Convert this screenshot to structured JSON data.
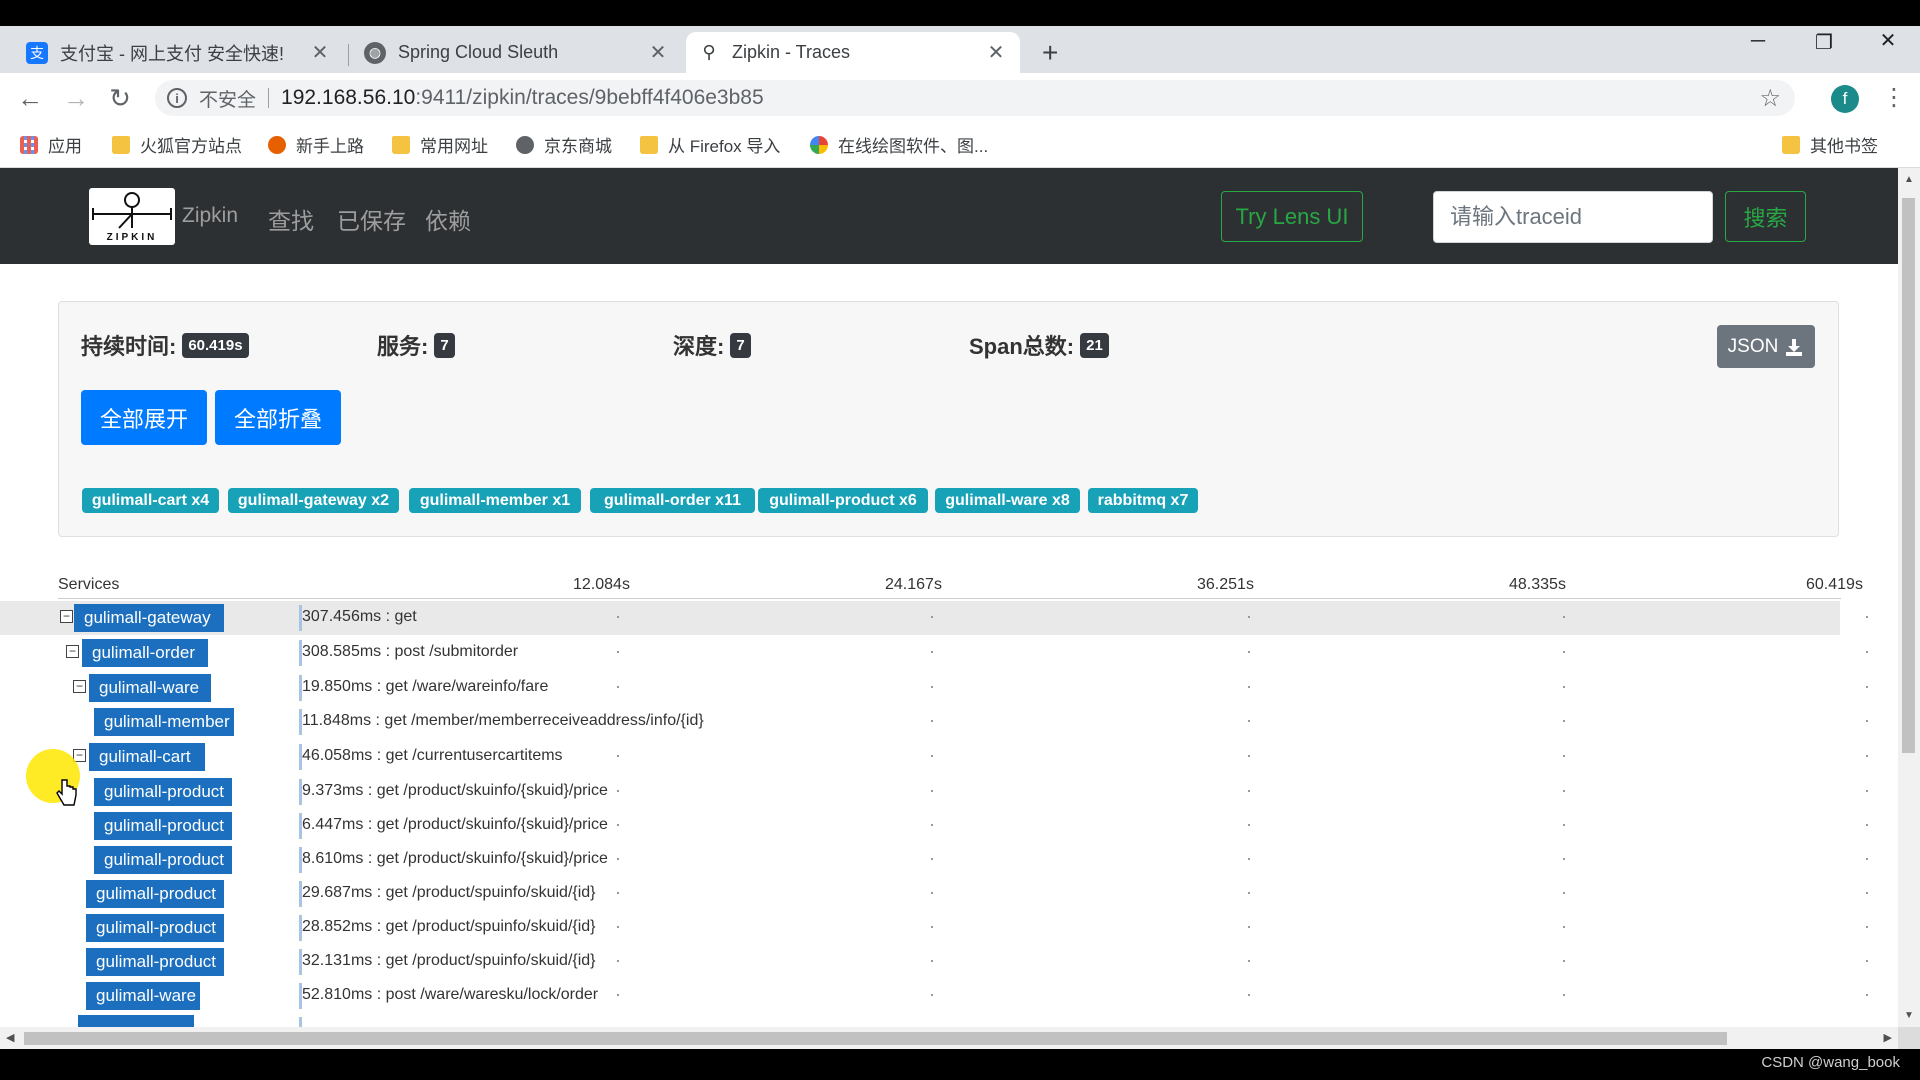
{
  "browser": {
    "tabs": [
      {
        "title": "支付宝 - 网上支付 安全快速!",
        "favicon": "alipay-icon",
        "active": false
      },
      {
        "title": "Spring Cloud Sleuth",
        "favicon": "globe-icon",
        "active": false
      },
      {
        "title": "Zipkin - Traces",
        "favicon": "zipkin-icon",
        "active": true
      }
    ],
    "new_tab": "+",
    "address": {
      "security_label": "不安全",
      "host": "192.168.56.10",
      "path": ":9411/zipkin/traces/9bebff4f406e3b85"
    },
    "profile_initial": "f",
    "bookmarks": [
      "应用",
      "火狐官方站点",
      "新手上路",
      "常用网址",
      "京东商城",
      "从 Firefox 导入",
      "在线绘图软件、图...",
      "其他书签"
    ]
  },
  "nav": {
    "brand": "Zipkin",
    "logo_text": "ZIPKIN",
    "links": [
      "查找",
      "已保存",
      "依赖"
    ],
    "lens_button": "Try Lens UI",
    "search_placeholder": "请输入traceid",
    "search_button": "搜索"
  },
  "summary": {
    "duration_label": "持续时间:",
    "duration_value": "60.419s",
    "services_label": "服务:",
    "services_value": "7",
    "depth_label": "深度:",
    "depth_value": "7",
    "spans_label": "Span总数:",
    "spans_value": "21",
    "json_button": "JSON",
    "expand_all": "全部展开",
    "collapse_all": "全部折叠",
    "service_badges": [
      "gulimall-cart x4",
      "gulimall-gateway x2",
      "gulimall-member x1",
      "gulimall-order x11",
      "gulimall-product x6",
      "gulimall-ware x8",
      "rabbitmq x7"
    ]
  },
  "timeline": {
    "services_header": "Services",
    "ticks": [
      "12.084s",
      "24.167s",
      "36.251s",
      "48.335s",
      "60.419s"
    ],
    "rows": [
      {
        "service": "gulimall-gateway",
        "label": "307.456ms : get"
      },
      {
        "service": "gulimall-order",
        "label": "308.585ms : post /submitorder"
      },
      {
        "service": "gulimall-ware",
        "label": "19.850ms : get /ware/wareinfo/fare"
      },
      {
        "service": "gulimall-member",
        "label": "11.848ms : get /member/memberreceiveaddress/info/{id}"
      },
      {
        "service": "gulimall-cart",
        "label": "46.058ms : get /currentusercartitems"
      },
      {
        "service": "gulimall-product",
        "label": "9.373ms : get /product/skuinfo/{skuid}/price"
      },
      {
        "service": "gulimall-product",
        "label": "6.447ms : get /product/skuinfo/{skuid}/price"
      },
      {
        "service": "gulimall-product",
        "label": "8.610ms : get /product/skuinfo/{skuid}/price"
      },
      {
        "service": "gulimall-product",
        "label": "29.687ms : get /product/spuinfo/skuid/{id}"
      },
      {
        "service": "gulimall-product",
        "label": "28.852ms : get /product/spuinfo/skuid/{id}"
      },
      {
        "service": "gulimall-product",
        "label": "32.131ms : get /product/spuinfo/skuid/{id}"
      },
      {
        "service": "gulimall-ware",
        "label": "52.810ms : post /ware/waresku/lock/order"
      }
    ]
  },
  "watermark": "CSDN @wang_book",
  "colors": {
    "nav_bg": "#2d3033",
    "service_bar": "#1b6fbe",
    "badge": "#17a2b8",
    "button": "#007bff",
    "success": "#28a745"
  }
}
